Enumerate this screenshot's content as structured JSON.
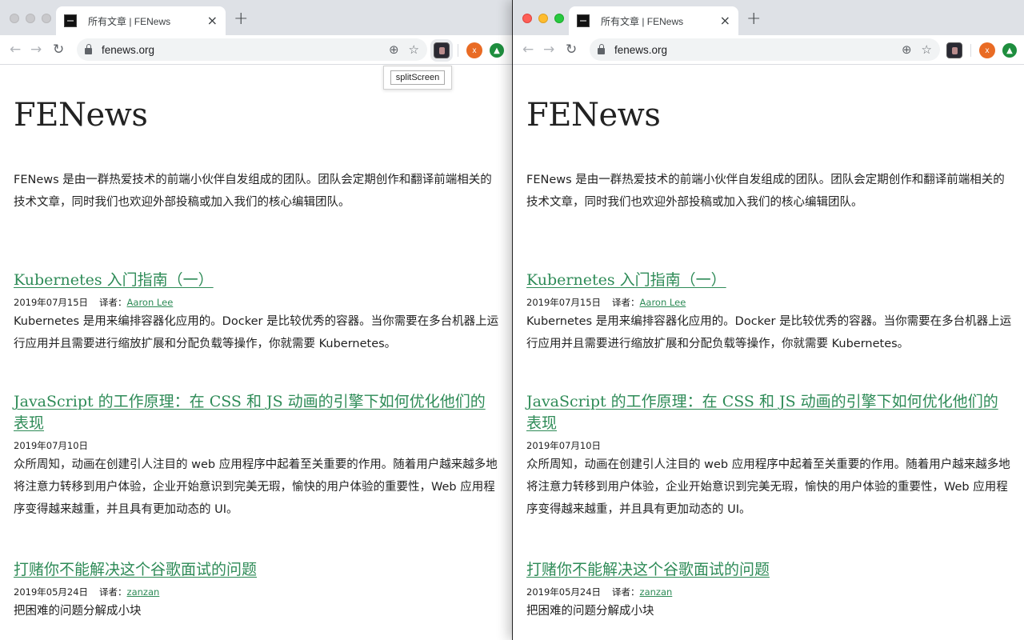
{
  "browser": {
    "tab_title": "所有文章 | FENews",
    "tab_close": "×",
    "new_tab": "+",
    "url": "fenews.org",
    "ext_x_label": "x",
    "ext_green_label": "▲",
    "tooltip": "splitScreen"
  },
  "page": {
    "site_title": "FENews",
    "intro": "FENews 是由一群热爱技术的前端小伙伴自发组成的团队。团队会定期创作和翻译前端相关的技术文章，同时我们也欢迎外部投稿或加入我们的核心编辑团队。",
    "posts": [
      {
        "title": "Kubernetes 入门指南（一）",
        "date": "2019年07月15日",
        "translator_label": "译者：",
        "translator": "Aaron Lee",
        "excerpt": "Kubernetes 是用来编排容器化应用的。Docker 是比较优秀的容器。当你需要在多台机器上运行应用并且需要进行缩放扩展和分配负载等操作，你就需要 Kubernetes。"
      },
      {
        "title": "JavaScript 的工作原理：在 CSS 和 JS 动画的引擎下如何优化他们的表现",
        "date": "2019年07月10日",
        "excerpt": "众所周知，动画在创建引人注目的 web 应用程序中起着至关重要的作用。随着用户越来越多地将注意力转移到用户体验，企业开始意识到完美无瑕，愉快的用户体验的重要性，Web 应用程序变得越来越重，并且具有更加动态的 UI。"
      },
      {
        "title": "打赌你不能解决这个谷歌面试的问题",
        "date": "2019年05月24日",
        "translator_label": "译者：",
        "translator": "zanzan",
        "excerpt": "把困难的问题分解成小块"
      }
    ]
  },
  "colors": {
    "link_green": "#2e8b57",
    "tabstrip": "#dee1e6",
    "ext_orange": "#e96b24",
    "ext_green": "#1e8e3e"
  }
}
